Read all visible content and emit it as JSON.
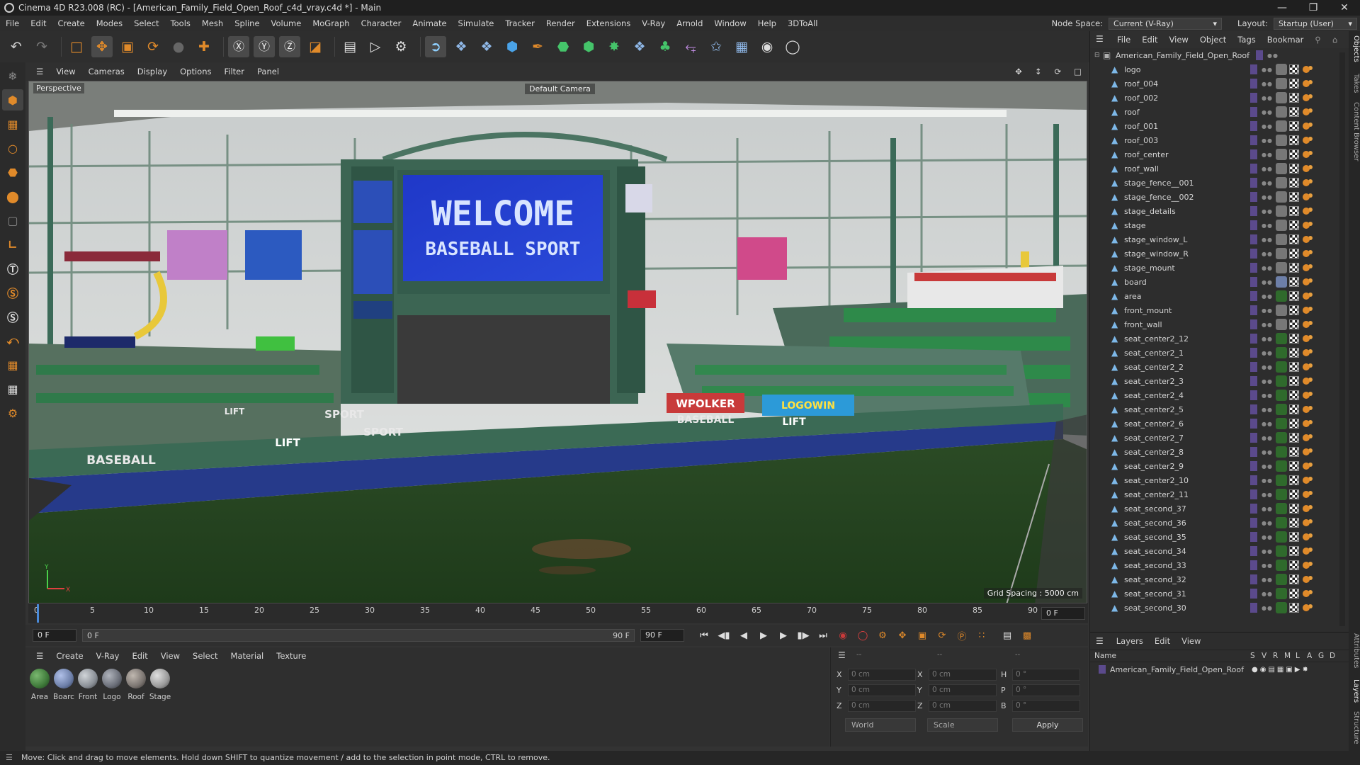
{
  "window": {
    "title": "Cinema 4D R23.008 (RC) - [American_Family_Field_Open_Roof_c4d_vray.c4d *] - Main",
    "controls": [
      "—",
      "❐",
      "✕"
    ]
  },
  "menu": {
    "items": [
      "File",
      "Edit",
      "Create",
      "Modes",
      "Select",
      "Tools",
      "Mesh",
      "Spline",
      "Volume",
      "MoGraph",
      "Character",
      "Animate",
      "Simulate",
      "Tracker",
      "Render",
      "Extensions",
      "V-Ray",
      "Arnold",
      "Window",
      "Help",
      "3DToAll"
    ],
    "node_space_label": "Node Space:",
    "node_space_value": "Current (V-Ray)",
    "layout_label": "Layout:",
    "layout_value": "Startup (User)"
  },
  "viewport": {
    "menu": [
      "View",
      "Cameras",
      "Display",
      "Options",
      "Filter",
      "Panel"
    ],
    "view_name": "Perspective",
    "camera": "Default Camera",
    "grid_spacing": "Grid Spacing : 5000 cm",
    "scene": {
      "welcome_line1": "WELCOME",
      "welcome_line2": "BASEBALL SPORT",
      "sign_polker": "WPOLKER",
      "sign_baseball_center": "BASEBALL",
      "sign_baseball_left": "BASEBALL",
      "sign_sport1": "SPORT",
      "sign_sport2": "SPORT",
      "sign_lift1": "LIFT",
      "sign_lift2": "LIFT",
      "sign_lift3": "LIFT",
      "sign_logowin": "LOGOWIN"
    },
    "axis": {
      "x": "X",
      "y": "Y"
    }
  },
  "timeline": {
    "ticks": [
      "0",
      "5",
      "10",
      "15",
      "20",
      "25",
      "30",
      "35",
      "40",
      "45",
      "50",
      "55",
      "60",
      "65",
      "70",
      "75",
      "80",
      "85",
      "90"
    ],
    "current_frame": "0 F"
  },
  "playbar": {
    "start": "0 F",
    "range_start": "0 F",
    "range_end": "90 F",
    "end": "90 F"
  },
  "material_manager": {
    "menu": [
      "Create",
      "V-Ray",
      "Edit",
      "View",
      "Select",
      "Material",
      "Texture"
    ],
    "materials": [
      {
        "name": "Area",
        "color": "#3f7a3a"
      },
      {
        "name": "Boarc",
        "color": "#6d7fa8"
      },
      {
        "name": "Front",
        "color": "#8a8f96"
      },
      {
        "name": "Logo",
        "color": "#6a6e78"
      },
      {
        "name": "Roof",
        "color": "#7a7470"
      },
      {
        "name": "Stage",
        "color": "#9a9a9a"
      }
    ]
  },
  "coordinates": {
    "dash1": "--",
    "dash2": "--",
    "dash3": "--",
    "rows": [
      {
        "a": "X",
        "av": "0 cm",
        "b": "X",
        "bv": "0 cm",
        "c": "H",
        "cv": "0 °"
      },
      {
        "a": "Y",
        "av": "0 cm",
        "b": "Y",
        "bv": "0 cm",
        "c": "P",
        "cv": "0 °"
      },
      {
        "a": "Z",
        "av": "0 cm",
        "b": "Z",
        "bv": "0 cm",
        "c": "B",
        "cv": "0 °"
      }
    ],
    "world": "World",
    "scale": "Scale",
    "apply": "Apply"
  },
  "objects": {
    "menu": [
      "File",
      "Edit",
      "View",
      "Object",
      "Tags",
      "Bookmar"
    ],
    "root": "American_Family_Field_Open_Roof",
    "items": [
      "logo",
      "roof_004",
      "roof_002",
      "roof",
      "roof_001",
      "roof_003",
      "roof_center",
      "roof_wall",
      "stage_fence__001",
      "stage_fence__002",
      "stage_details",
      "stage",
      "stage_window_L",
      "stage_window_R",
      "stage_mount",
      "board",
      "area",
      "front_mount",
      "front_wall",
      "seat_center2_12",
      "seat_center2_1",
      "seat_center2_2",
      "seat_center2_3",
      "seat_center2_4",
      "seat_center2_5",
      "seat_center2_6",
      "seat_center2_7",
      "seat_center2_8",
      "seat_center2_9",
      "seat_center2_10",
      "seat_center2_11",
      "seat_second_37",
      "seat_second_36",
      "seat_second_35",
      "seat_second_34",
      "seat_second_33",
      "seat_second_32",
      "seat_second_31",
      "seat_second_30"
    ]
  },
  "layers": {
    "menu": [
      "Layers",
      "Edit",
      "View"
    ],
    "name_header": "Name",
    "cols": [
      "S",
      "V",
      "R",
      "M",
      "L",
      "A",
      "G",
      "D"
    ],
    "items": [
      "American_Family_Field_Open_Roof"
    ]
  },
  "right_tabs": [
    "Objects",
    "Takes",
    "Content Browser",
    "Attributes",
    "Layers",
    "Structure"
  ],
  "status": "Move: Click and drag to move elements. Hold down SHIFT to quantize movement / add to the selection in point mode, CTRL to remove."
}
